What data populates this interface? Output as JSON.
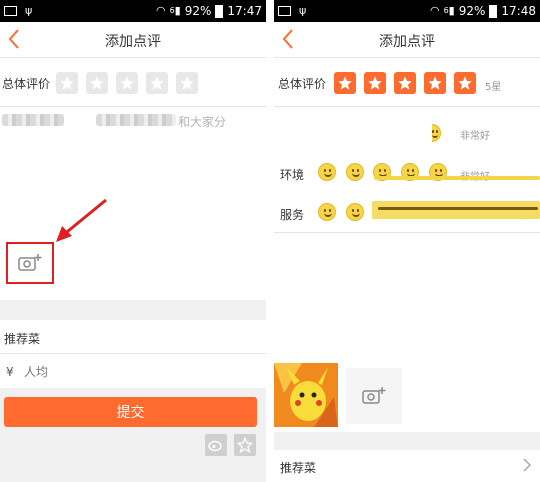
{
  "status_left": {
    "battery_pct": "92%",
    "time": "17:47",
    "signal_tag": "6"
  },
  "status_right": {
    "battery_pct": "92%",
    "time": "17:48",
    "signal_tag": "6"
  },
  "left": {
    "nav_title": "添加点评",
    "overall_label": "总体评价",
    "review_fragment": "和大家分",
    "recommend_label": "推荐菜",
    "per_person_currency": "¥",
    "per_person_placeholder": "人均",
    "submit_label": "提交"
  },
  "right": {
    "nav_title": "添加点评",
    "overall_label": "总体评价",
    "stars_value": "5星",
    "taste_word": "非常好",
    "env_label": "环境",
    "env_word": "非常好",
    "service_label": "服务",
    "recommend_label": "推荐菜"
  },
  "ratings": {
    "left_overall_stars": 0,
    "right_overall_stars": 5,
    "max_stars": 5
  },
  "colors": {
    "accent": "#ff6a2e",
    "highlight": "#e02020",
    "star_off": "#e8e8e8",
    "face": "#f7d54a"
  },
  "icons": {
    "back": "chevron-left-icon",
    "star": "star-icon",
    "camera_add": "camera-add-icon",
    "arrow": "red-arrow-icon",
    "weibo": "weibo-icon",
    "favorite": "star-outline-icon",
    "chevron_right": "chevron-right-icon"
  }
}
